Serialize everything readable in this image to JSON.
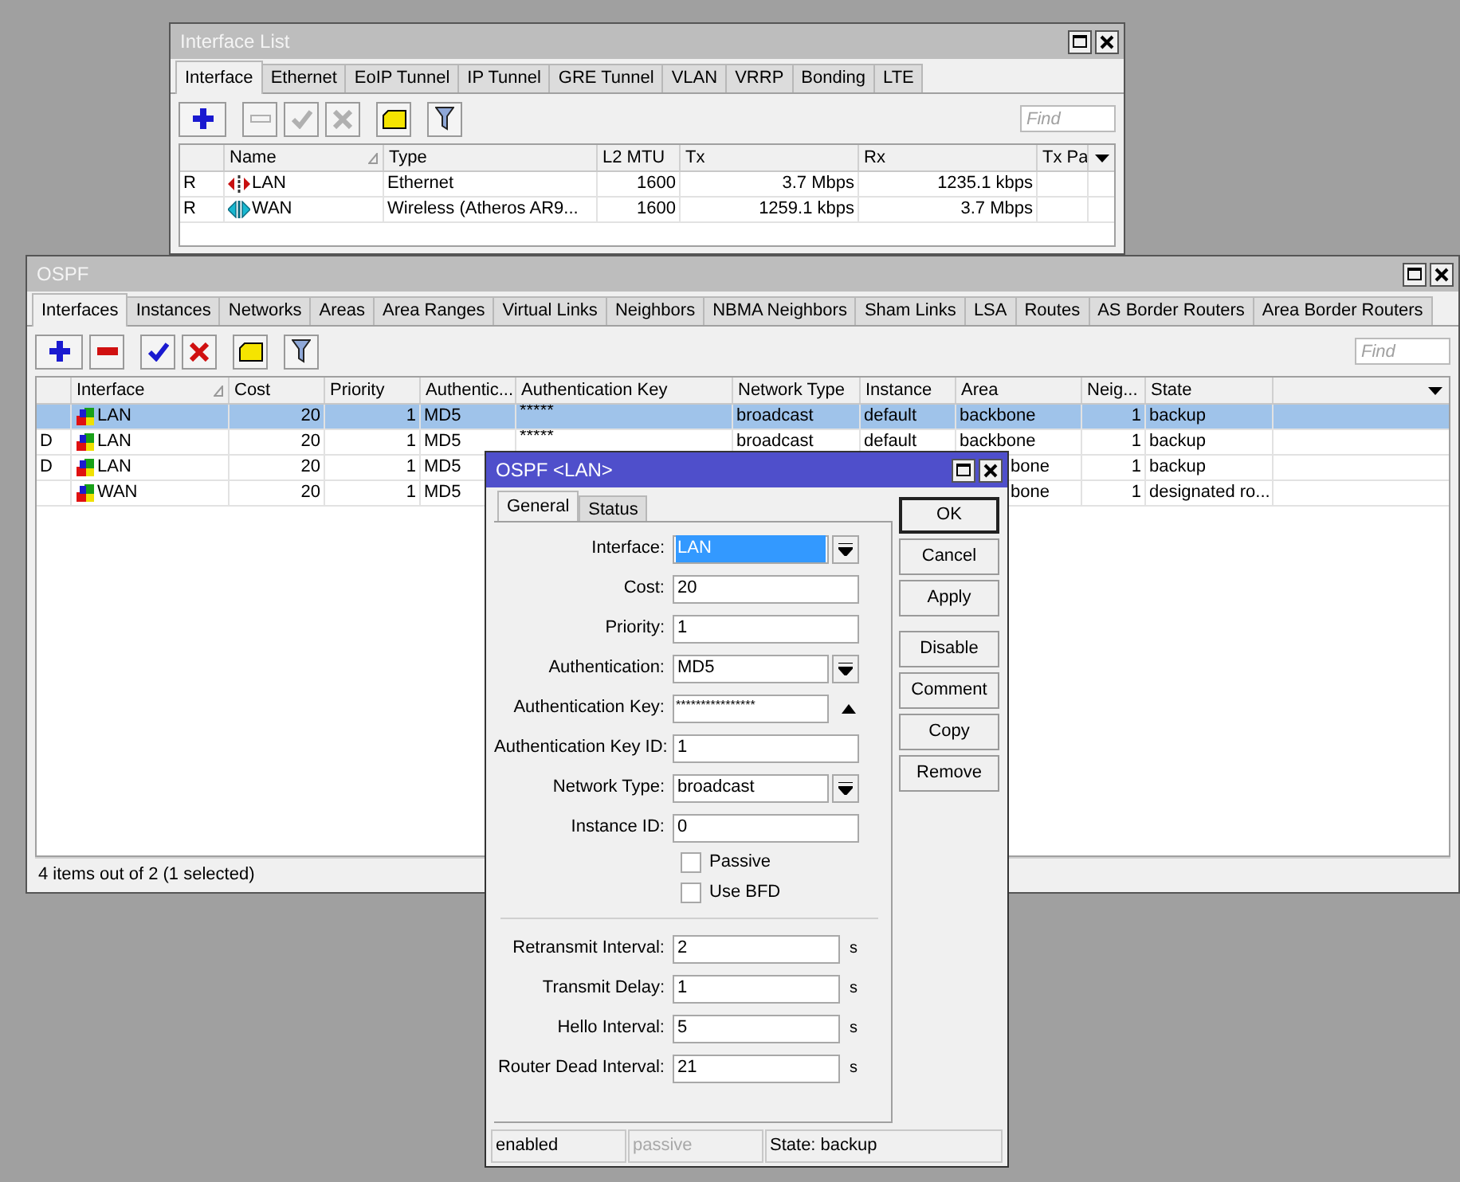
{
  "interface_list": {
    "title": "Interface List",
    "active": false,
    "tabs": [
      {
        "label": "Interface",
        "selected": true
      },
      {
        "label": "Ethernet",
        "selected": false
      },
      {
        "label": "EoIP Tunnel",
        "selected": false
      },
      {
        "label": "IP Tunnel",
        "selected": false
      },
      {
        "label": "GRE Tunnel",
        "selected": false
      },
      {
        "label": "VLAN",
        "selected": false
      },
      {
        "label": "VRRP",
        "selected": false
      },
      {
        "label": "Bonding",
        "selected": false
      },
      {
        "label": "LTE",
        "selected": false
      }
    ],
    "toolbar": [
      {
        "kind": "add",
        "disabled": false
      },
      {
        "kind": "remove",
        "disabled": true
      },
      {
        "kind": "enable",
        "disabled": true
      },
      {
        "kind": "disable",
        "disabled": true
      },
      {
        "kind": "comment",
        "disabled": false
      },
      {
        "kind": "filter",
        "disabled": false
      }
    ],
    "search": {
      "placeholder": "Find"
    },
    "columns": [
      {
        "label": "Name",
        "sorted": true
      },
      {
        "label": "Type",
        "sorted": false
      },
      {
        "label": "L2 MTU",
        "sorted": false
      },
      {
        "label": "Tx",
        "sorted": false
      },
      {
        "label": "Rx",
        "sorted": false
      },
      {
        "label": "Tx Pa",
        "sorted": false
      }
    ],
    "rows": [
      {
        "flag": "R",
        "kind": "ethernet",
        "name": "LAN",
        "type": "Ethernet",
        "l2mtu": "1600",
        "tx": "3.7 Mbps",
        "rx": "1235.1 kbps"
      },
      {
        "flag": "R",
        "kind": "wireless",
        "name": "WAN",
        "type": "Wireless (Atheros AR9...",
        "l2mtu": "1600",
        "tx": "1259.1 kbps",
        "rx": "3.7 Mbps"
      }
    ]
  },
  "ospf": {
    "title": "OSPF",
    "active": false,
    "tabs": [
      {
        "label": "Interfaces",
        "selected": true
      },
      {
        "label": "Instances",
        "selected": false
      },
      {
        "label": "Networks",
        "selected": false
      },
      {
        "label": "Areas",
        "selected": false
      },
      {
        "label": "Area Ranges",
        "selected": false
      },
      {
        "label": "Virtual Links",
        "selected": false
      },
      {
        "label": "Neighbors",
        "selected": false
      },
      {
        "label": "NBMA Neighbors",
        "selected": false
      },
      {
        "label": "Sham Links",
        "selected": false
      },
      {
        "label": "LSA",
        "selected": false
      },
      {
        "label": "Routes",
        "selected": false
      },
      {
        "label": "AS Border Routers",
        "selected": false
      },
      {
        "label": "Area Border Routers",
        "selected": false
      }
    ],
    "toolbar": [
      {
        "kind": "add",
        "disabled": false
      },
      {
        "kind": "remove",
        "disabled": false
      },
      {
        "kind": "enable",
        "disabled": false
      },
      {
        "kind": "disable",
        "disabled": false
      },
      {
        "kind": "comment",
        "disabled": false
      },
      {
        "kind": "filter",
        "disabled": false
      }
    ],
    "search": {
      "placeholder": "Find"
    },
    "columns": [
      {
        "label": "Interface",
        "sorted": true
      },
      {
        "label": "Cost",
        "sorted": false
      },
      {
        "label": "Priority",
        "sorted": false
      },
      {
        "label": "Authentic...",
        "sorted": false
      },
      {
        "label": "Authentication Key",
        "sorted": false
      },
      {
        "label": "Network Type",
        "sorted": false
      },
      {
        "label": "Instance",
        "sorted": false
      },
      {
        "label": "Area",
        "sorted": false
      },
      {
        "label": "Neig...",
        "sorted": false
      },
      {
        "label": "State",
        "sorted": false
      }
    ],
    "rows": [
      {
        "flag": "",
        "selected": true,
        "interface": "LAN",
        "cost": "20",
        "priority": "1",
        "authentication": "MD5",
        "authentication_key": "*****",
        "network_type": "broadcast",
        "instance": "default",
        "area": "backbone",
        "area_covered": false,
        "neighbors": "1",
        "state": "backup"
      },
      {
        "flag": "D",
        "selected": false,
        "interface": "LAN",
        "cost": "20",
        "priority": "1",
        "authentication": "MD5",
        "authentication_key": "*****",
        "network_type": "broadcast",
        "instance": "default",
        "area": "backbone",
        "area_covered": false,
        "neighbors": "1",
        "state": "backup"
      },
      {
        "flag": "D",
        "selected": false,
        "interface": "LAN",
        "cost": "20",
        "priority": "1",
        "authentication": "MD5",
        "area": "bone",
        "area_covered": true,
        "neighbors": "1",
        "state": "backup"
      },
      {
        "flag": "",
        "selected": false,
        "interface": "WAN",
        "cost": "20",
        "priority": "1",
        "authentication": "MD5",
        "area": "bone",
        "area_covered": true,
        "neighbors": "1",
        "state": "designated ro..."
      }
    ],
    "status": "4 items out of 2 (1 selected)"
  },
  "dialog": {
    "title": "OSPF <LAN>",
    "active": true,
    "tabs": [
      {
        "label": "General",
        "selected": true
      },
      {
        "label": "Status",
        "selected": false
      }
    ],
    "fields": [
      {
        "kind": "dropdown",
        "label": "Interface:",
        "value": "LAN",
        "highlighted": true
      },
      {
        "kind": "text",
        "label": "Cost:",
        "value": "20",
        "highlighted": false
      },
      {
        "kind": "text",
        "label": "Priority:",
        "value": "1",
        "highlighted": false
      },
      {
        "kind": "dropdown",
        "label": "Authentication:",
        "value": "MD5",
        "highlighted": false
      },
      {
        "kind": "key",
        "label": "Authentication Key:",
        "value": "****************",
        "highlighted": false
      },
      {
        "kind": "text",
        "label": "Authentication Key ID:",
        "value": "1",
        "highlighted": false
      },
      {
        "kind": "dropdown",
        "label": "Network Type:",
        "value": "broadcast",
        "highlighted": false
      },
      {
        "kind": "text",
        "label": "Instance ID:",
        "value": "0",
        "highlighted": false
      },
      {
        "kind": "checkbox",
        "label": "Passive",
        "checked": false
      },
      {
        "kind": "checkbox",
        "label": "Use BFD",
        "checked": false
      },
      {
        "kind": "separator"
      },
      {
        "kind": "unit",
        "label": "Retransmit Interval:",
        "value": "2",
        "unit": "s",
        "highlighted": false
      },
      {
        "kind": "unit",
        "label": "Transmit Delay:",
        "value": "1",
        "unit": "s",
        "highlighted": false
      },
      {
        "kind": "unit",
        "label": "Hello Interval:",
        "value": "5",
        "unit": "s",
        "highlighted": false
      },
      {
        "kind": "unit",
        "label": "Router Dead Interval:",
        "value": "21",
        "unit": "s",
        "highlighted": false
      }
    ],
    "buttons": [
      {
        "label": "OK",
        "default": true
      },
      {
        "label": "Cancel",
        "default": false
      },
      {
        "label": "Apply",
        "default": false
      },
      {
        "label": "Disable",
        "default": false
      },
      {
        "label": "Comment",
        "default": false
      },
      {
        "label": "Copy",
        "default": false
      },
      {
        "label": "Remove",
        "default": false
      }
    ],
    "status": [
      {
        "text": "enabled",
        "disabled": false
      },
      {
        "text": "passive",
        "disabled": true
      },
      {
        "text": "State: backup",
        "disabled": false
      }
    ]
  }
}
